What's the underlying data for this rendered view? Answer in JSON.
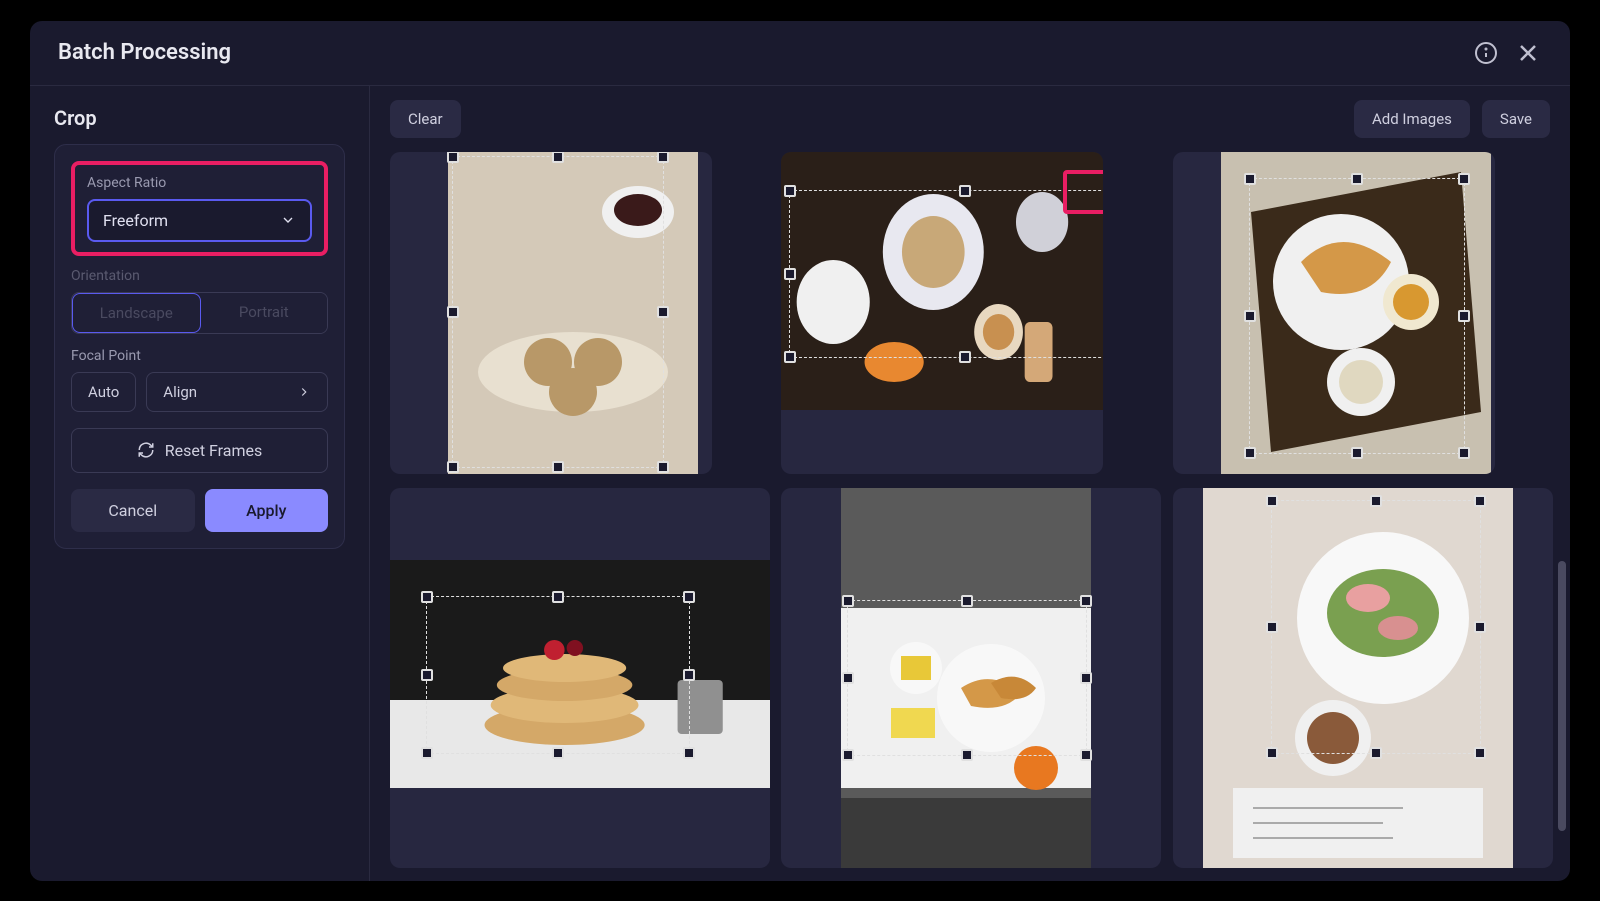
{
  "header": {
    "title": "Batch Processing"
  },
  "sidebar": {
    "title": "Crop",
    "aspect_ratio_label": "Aspect Ratio",
    "aspect_ratio_value": "Freeform",
    "orientation_label": "Orientation",
    "orientation_landscape": "Landscape",
    "orientation_portrait": "Portrait",
    "focal_point_label": "Focal Point",
    "focal_auto": "Auto",
    "focal_align": "Align",
    "reset_frames": "Reset Frames",
    "cancel": "Cancel",
    "apply": "Apply"
  },
  "toolbar": {
    "clear": "Clear",
    "add_images": "Add Images",
    "save": "Save"
  },
  "colors": {
    "accent": "#8a8aff",
    "highlight": "#e91e63",
    "panel": "#1f1f36",
    "bg": "#1a1a2e"
  },
  "images": [
    {
      "id": "img-1",
      "desc": "scones on plate with coffee cup"
    },
    {
      "id": "img-2",
      "desc": "overhead brunch spread on dark table"
    },
    {
      "id": "img-3",
      "desc": "croissant and coffee on tray"
    },
    {
      "id": "img-4",
      "desc": "pancake stack with berries"
    },
    {
      "id": "img-5",
      "desc": "croissants breakfast plate overhead"
    },
    {
      "id": "img-6",
      "desc": "salad plate with cappuccino"
    }
  ]
}
